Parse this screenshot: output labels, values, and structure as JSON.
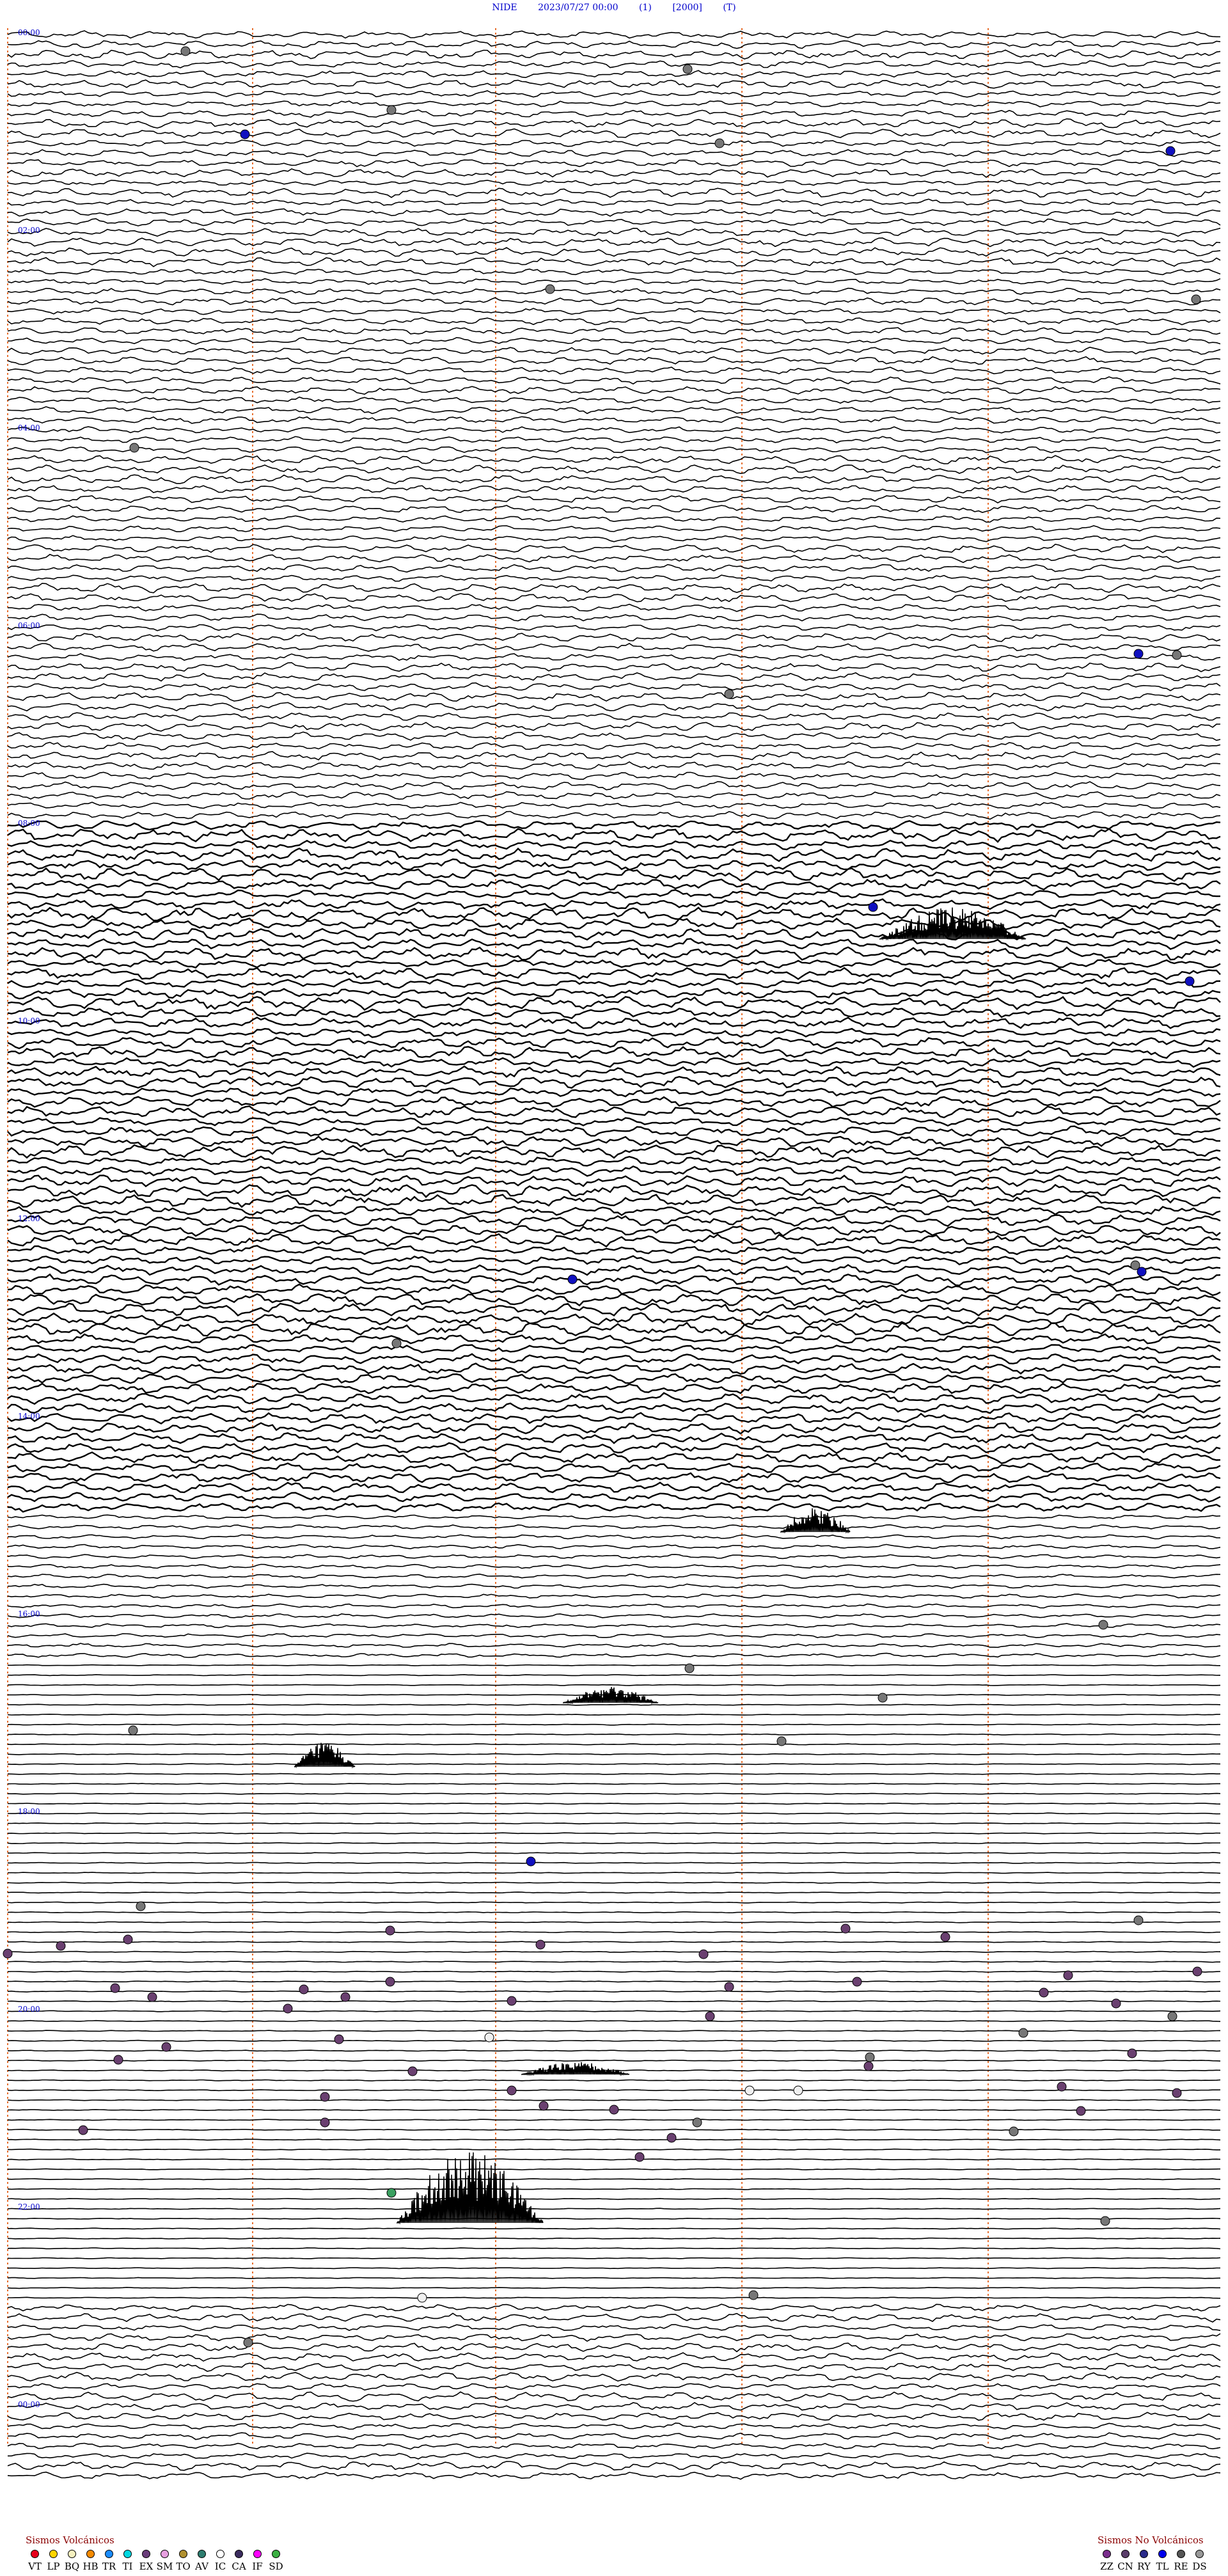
{
  "header": {
    "station": "NIDE",
    "datetime": "2023/07/27 00:00",
    "channel": "(1)",
    "scale": "[2000]",
    "mode": "(T)"
  },
  "hour_labels": [
    "00:00",
    "02:00",
    "04:00",
    "06:00",
    "08:00",
    "10:00",
    "12:00",
    "14:00",
    "16:00",
    "18:00",
    "20:00",
    "22:00",
    "00:00"
  ],
  "legend_volcanic": {
    "title": "Sismos Volcánicos",
    "items": [
      {
        "code": "VT",
        "color": "#e8001c"
      },
      {
        "code": "LP",
        "color": "#ffd400"
      },
      {
        "code": "BQ",
        "color": "#f5f0c0"
      },
      {
        "code": "HB",
        "color": "#f48a00"
      },
      {
        "code": "TR",
        "color": "#1a8cff"
      },
      {
        "code": "TI",
        "color": "#00d7e0"
      },
      {
        "code": "EX",
        "color": "#6a3d7a"
      },
      {
        "code": "SM",
        "color": "#e7a0e0"
      },
      {
        "code": "TO",
        "color": "#b09030"
      },
      {
        "code": "AV",
        "color": "#2e7d6f"
      },
      {
        "code": "IC",
        "color": "#ffffff"
      },
      {
        "code": "CA",
        "color": "#3b2c5e"
      },
      {
        "code": "IF",
        "color": "#ff00ff"
      },
      {
        "code": "SD",
        "color": "#3cb043"
      }
    ]
  },
  "legend_nonvolcanic": {
    "title": "Sismos No Volcánicos",
    "items": [
      {
        "code": "ZZ",
        "color": "#7a2d8c"
      },
      {
        "code": "CN",
        "color": "#5a3d6a"
      },
      {
        "code": "RY",
        "color": "#2a2a8a"
      },
      {
        "code": "TL",
        "color": "#0000ee"
      },
      {
        "code": "RE",
        "color": "#555555"
      },
      {
        "code": "DS",
        "color": "#999999"
      }
    ]
  },
  "colors": {
    "trace": "#000000",
    "minute_marker": "#e87030",
    "hour_label": "#0000cc"
  }
}
